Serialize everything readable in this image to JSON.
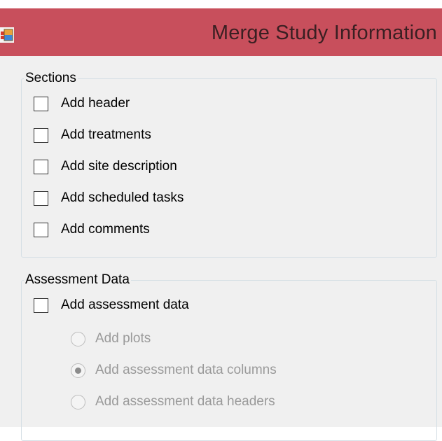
{
  "window": {
    "title": "Merge Study Information",
    "icon": "app-window-icon",
    "titlebar_color": "#c84f5c"
  },
  "sections": {
    "label": "Sections",
    "items": [
      {
        "label": "Add header",
        "checked": false
      },
      {
        "label": "Add treatments",
        "checked": false
      },
      {
        "label": "Add site description",
        "checked": false
      },
      {
        "label": "Add scheduled tasks",
        "checked": false
      },
      {
        "label": "Add comments",
        "checked": false
      }
    ]
  },
  "assessment": {
    "label": "Assessment Data",
    "add_assessment_data": {
      "label": "Add assessment data",
      "checked": false
    },
    "options": [
      {
        "label": "Add plots",
        "selected": false,
        "enabled": false
      },
      {
        "label": "Add assessment data columns",
        "selected": true,
        "enabled": false
      },
      {
        "label": "Add assessment data headers",
        "selected": false,
        "enabled": false
      }
    ]
  }
}
